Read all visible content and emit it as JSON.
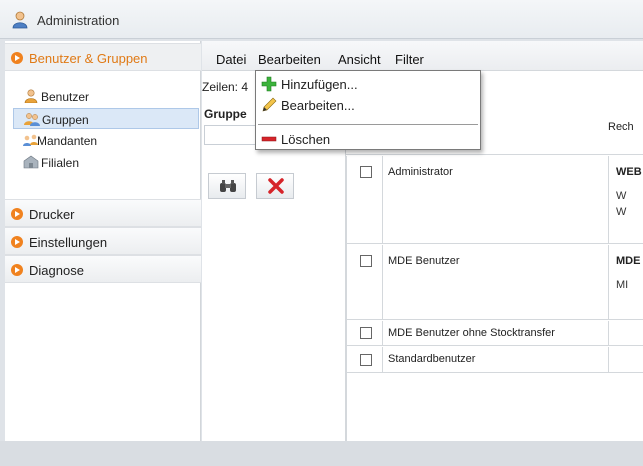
{
  "window": {
    "title": "Administration"
  },
  "sidebar": {
    "sections": [
      {
        "label": "Benutzer & Gruppen"
      },
      {
        "label": "Drucker"
      },
      {
        "label": "Einstellungen"
      },
      {
        "label": "Diagnose"
      }
    ],
    "items": [
      {
        "label": "Benutzer"
      },
      {
        "label": "Gruppen"
      },
      {
        "label": "Mandanten"
      },
      {
        "label": "Filialen"
      }
    ]
  },
  "menubar": {
    "items": [
      "Datei",
      "Bearbeiten",
      "Ansicht",
      "Filter"
    ]
  },
  "rows_label": "Zeilen: 4",
  "left_panel": {
    "group_header": "Gruppe"
  },
  "grid": {
    "col_right_header": "Rech",
    "rows": [
      {
        "name": "Administrator",
        "right": "WEB",
        "subs": [
          "W",
          "W"
        ]
      },
      {
        "name": "MDE Benutzer",
        "right": "MDE",
        "subs": [
          "MI"
        ]
      },
      {
        "name": "MDE Benutzer ohne Stocktransfer",
        "right": "",
        "subs": []
      },
      {
        "name": "Standardbenutzer",
        "right": "",
        "subs": []
      }
    ]
  },
  "dropdown": {
    "items": [
      {
        "label": "Hinzufügen...",
        "icon": "plus-icon"
      },
      {
        "label": "Bearbeiten...",
        "icon": "pencil-icon"
      },
      {
        "label": "Löschen",
        "icon": "minus-icon"
      }
    ]
  },
  "colors": {
    "accent": "#f0821f",
    "selected_bg": "#dbe8f7"
  }
}
